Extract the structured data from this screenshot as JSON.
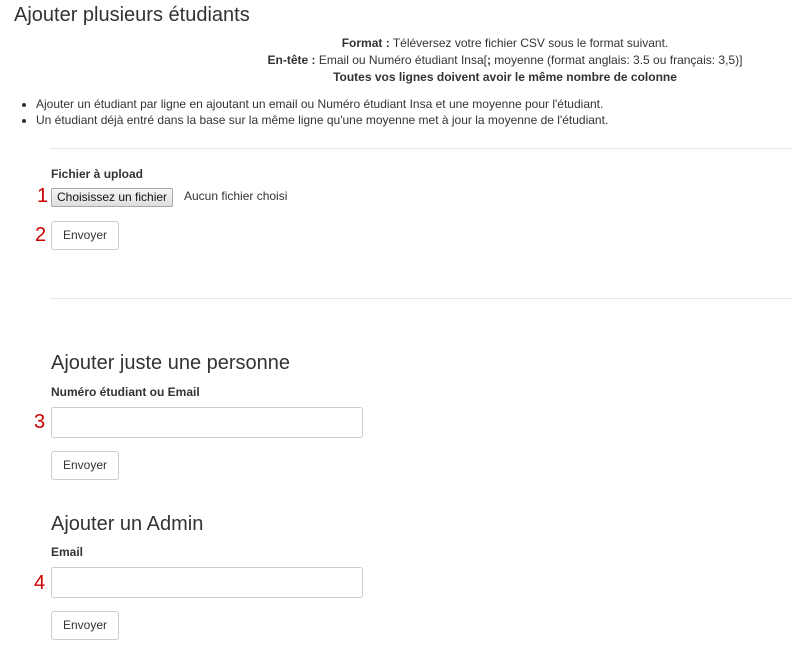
{
  "page": {
    "title": "Ajouter plusieurs étudiants"
  },
  "format_info": {
    "format_label": "Format :",
    "format_text": " Téléversez votre fichier CSV sous le format suivant.",
    "header_label": "En-tête :",
    "header_text_1": " Email ou Numéro étudiant Insa[",
    "header_sep": ";",
    "header_text_2": " moyenne (format anglais: 3.5 ou français: 3,5)]",
    "rule": "Toutes vos lignes doivent avoir le même nombre de colonne"
  },
  "notes": [
    "Ajouter un étudiant par ligne en ajoutant un email ou Numéro étudiant Insa et une moyenne pour l'étudiant.",
    "Un étudiant déjà entré dans la base sur la même ligne qu'une moyenne met à jour la moyenne de l'étudiant."
  ],
  "upload": {
    "label": "Fichier à upload",
    "choose_button": "Choisissez un fichier",
    "no_file": "Aucun fichier choisi",
    "submit": "Envoyer"
  },
  "single": {
    "heading": "Ajouter juste une personne",
    "label": "Numéro étudiant ou Email",
    "value": "",
    "submit": "Envoyer"
  },
  "admin": {
    "heading": "Ajouter un Admin",
    "label": "Email",
    "value": "",
    "submit": "Envoyer"
  },
  "markers": [
    "1",
    "2",
    "3",
    "4"
  ],
  "colors": {
    "marker": "#cc0000",
    "text": "#333333",
    "border": "#cccccc"
  }
}
